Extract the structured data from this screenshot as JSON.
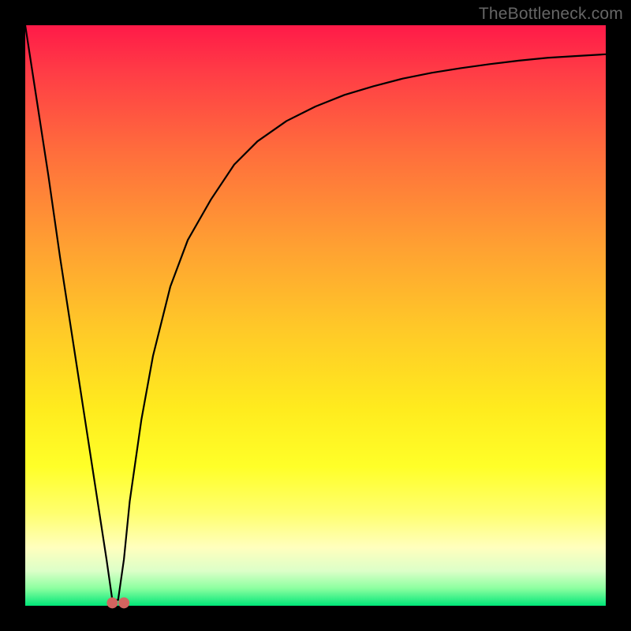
{
  "watermark": "TheBottleneck.com",
  "colors": {
    "frame": "#000000",
    "curve_stroke": "#000000",
    "marker_fill": "#d26460"
  },
  "chart_data": {
    "type": "line",
    "title": "",
    "xlabel": "",
    "ylabel": "",
    "xlim": [
      0,
      100
    ],
    "ylim": [
      0,
      100
    ],
    "legend": false,
    "grid": false,
    "series": [
      {
        "name": "curve",
        "x": [
          0,
          2,
          4,
          6,
          8,
          10,
          12,
          14,
          15,
          16,
          17,
          18,
          20,
          22,
          25,
          28,
          32,
          36,
          40,
          45,
          50,
          55,
          60,
          65,
          70,
          75,
          80,
          85,
          90,
          95,
          100
        ],
        "y": [
          100,
          87,
          74,
          60,
          47,
          34,
          21,
          8,
          1,
          1,
          8,
          18,
          32,
          43,
          55,
          63,
          70,
          76,
          80,
          83.5,
          86,
          88,
          89.5,
          90.8,
          91.8,
          92.6,
          93.3,
          93.9,
          94.4,
          94.7,
          95
        ]
      }
    ],
    "markers": [
      {
        "x": 15,
        "y": 0.5
      },
      {
        "x": 17,
        "y": 0.5
      }
    ]
  }
}
